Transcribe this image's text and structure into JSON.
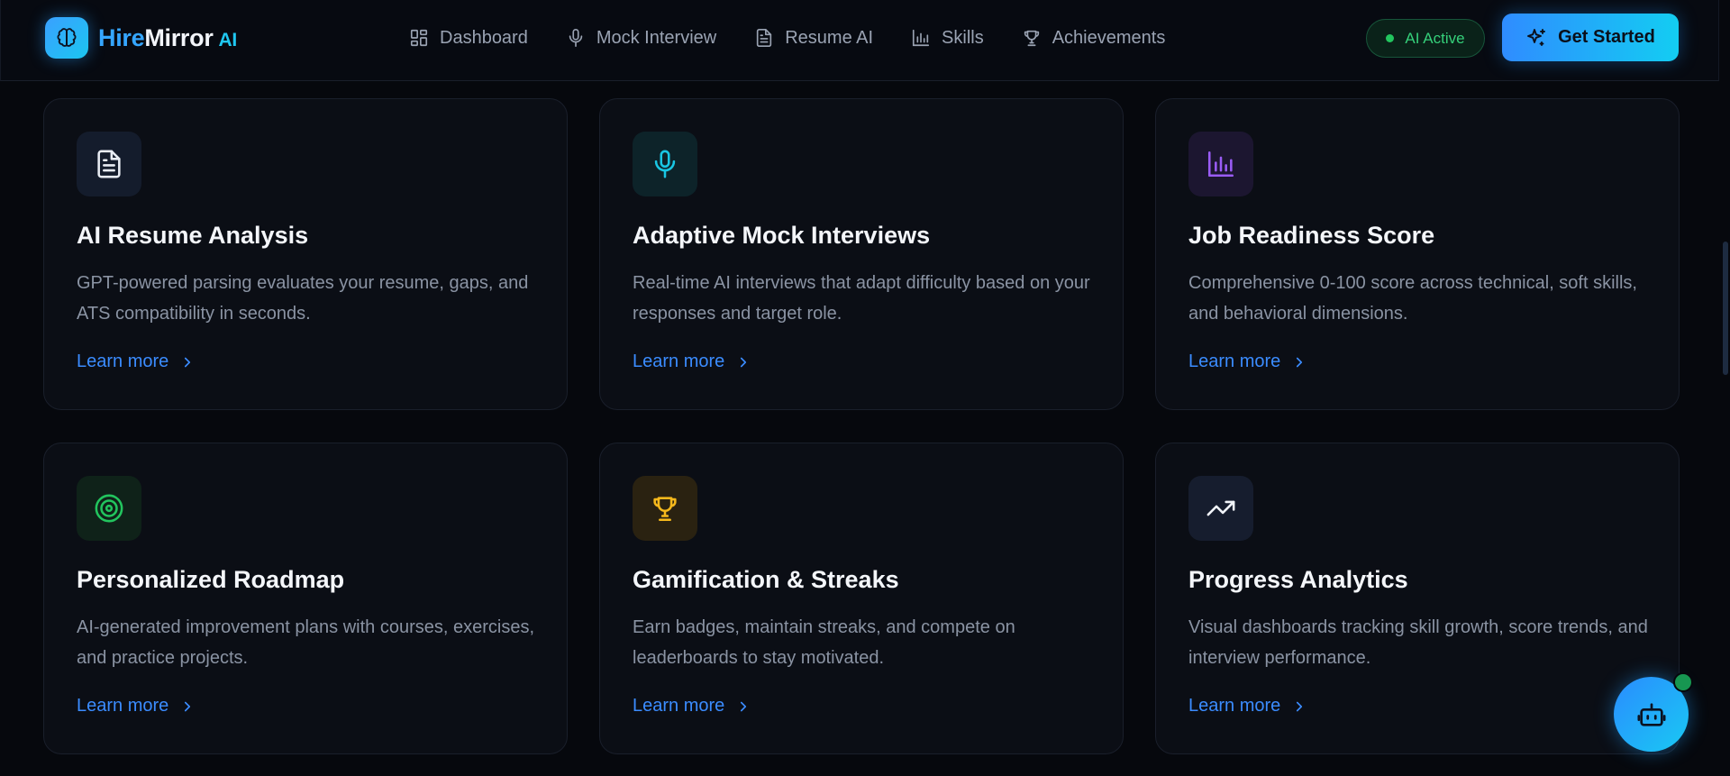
{
  "header": {
    "brand": {
      "hire": "Hire",
      "mirror": "Mirror",
      "ai": "AI"
    },
    "nav": [
      {
        "label": "Dashboard",
        "icon": "grid-icon"
      },
      {
        "label": "Mock Interview",
        "icon": "microphone-icon"
      },
      {
        "label": "Resume AI",
        "icon": "document-icon"
      },
      {
        "label": "Skills",
        "icon": "bar-chart-icon"
      },
      {
        "label": "Achievements",
        "icon": "trophy-icon"
      }
    ],
    "status": "AI Active",
    "cta": "Get Started"
  },
  "features": [
    {
      "title": "AI Resume Analysis",
      "desc": "GPT-powered parsing evaluates your resume, gaps, and ATS compatibility in seconds.",
      "link": "Learn more",
      "icon": "document-icon",
      "accent": "#e8ecf3",
      "iconBg": "#141c2c"
    },
    {
      "title": "Adaptive Mock Interviews",
      "desc": "Real-time AI interviews that adapt difficulty based on your responses and target role.",
      "link": "Learn more",
      "icon": "microphone-icon",
      "accent": "#19c6e3",
      "iconBg": "#0d2329"
    },
    {
      "title": "Job Readiness Score",
      "desc": "Comprehensive 0-100 score across technical, soft skills, and behavioral dimensions.",
      "link": "Learn more",
      "icon": "bar-chart-icon",
      "accent": "#9a5cf5",
      "iconBg": "#1c1630"
    },
    {
      "title": "Personalized Roadmap",
      "desc": "AI-generated improvement plans with courses, exercises, and practice projects.",
      "link": "Learn more",
      "icon": "target-icon",
      "accent": "#22c55e",
      "iconBg": "#0f2219"
    },
    {
      "title": "Gamification & Streaks",
      "desc": "Earn badges, maintain streaks, and compete on leaderboards to stay motivated.",
      "link": "Learn more",
      "icon": "trophy-icon",
      "accent": "#f5b81c",
      "iconBg": "#2a2211"
    },
    {
      "title": "Progress Analytics",
      "desc": "Visual dashboards tracking skill growth, score trends, and interview performance.",
      "link": "Learn more",
      "icon": "trending-up-icon",
      "accent": "#f1f4f9",
      "iconBg": "#161d2e"
    }
  ],
  "chatbot": {
    "icon": "robot-icon"
  }
}
